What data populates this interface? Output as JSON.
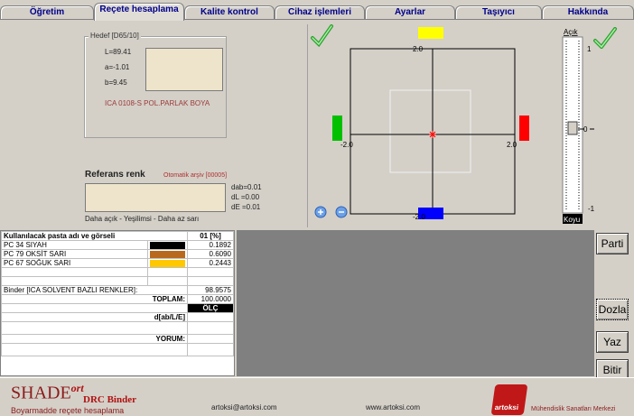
{
  "tabs": [
    "Öğretim",
    "Reçete hesaplama",
    "Kalite kontrol",
    "Cihaz işlemleri",
    "Ayarlar",
    "Taşıyıcı",
    "Hakkında"
  ],
  "target": {
    "legend": "Hedef [D65/10]",
    "L": "L=89.41",
    "a": "a=-1.01",
    "b": "b=9.45",
    "name": "ICA 0108-S POL.PARLAK BOYA",
    "swatch_color": "#eee4cb"
  },
  "reference": {
    "title": "Referans renk",
    "archive": "Otomatik arşiv [00005]",
    "dab": "dab=0.01",
    "dL": "dL =0.00",
    "dE": "dE =0.01",
    "hint": "Daha açık - Yeşilimsi - Daha az sarı",
    "swatch_color": "#eee4cb"
  },
  "plot": {
    "top_tick": "2.0",
    "left_tick": "-2.0",
    "right_tick": "2.0",
    "bottom_tick": "-2.0",
    "lightness_top": "Açık",
    "lightness_bottom": "Koyu",
    "scale_top": "1",
    "scale_mid": "0",
    "scale_bottom": "-1",
    "colors": {
      "yellow": "#ffff00",
      "green": "#00c000",
      "red": "#ff0000",
      "blue": "#0000ff",
      "marker": "#ff0000"
    }
  },
  "recipe": {
    "header_name": "Kullanılacak pasta adı ve görseli",
    "header_pct": "01 [%]",
    "rows": [
      {
        "name": "PC 34 SIYAH",
        "color": "#000000",
        "value": "0.1892"
      },
      {
        "name": "PC 79 OKSİT SARI",
        "color": "#b8691e",
        "value": "0.6090"
      },
      {
        "name": "PC 67 SOĞUK SARI",
        "color": "#ffc800",
        "value": "0.2443"
      }
    ],
    "binder": "Binder [ICA SOLVENT BAZLI RENKLER]:",
    "binder_value": "98.9575",
    "total_label": "TOPLAM:",
    "total_value": "100.0000",
    "measure": "ÖLÇ",
    "dlab_label": "d[ab/L/E]",
    "comment_label": "YORUM:"
  },
  "buttons": {
    "parti": "Parti",
    "dozla": "Dozla",
    "yaz": "Yaz",
    "bitir": "Bitir"
  },
  "footer": {
    "logo_main": "SHADE",
    "logo_sup": "ort",
    "product": "DRC Binder",
    "subtitle": "Boyarmadde reçete hesaplama",
    "email": "artoksi@artoksi.com",
    "website": "www.artoksi.com",
    "company_logo": "artoksi",
    "company": "Mühendislik Sanatları Merkezi"
  }
}
